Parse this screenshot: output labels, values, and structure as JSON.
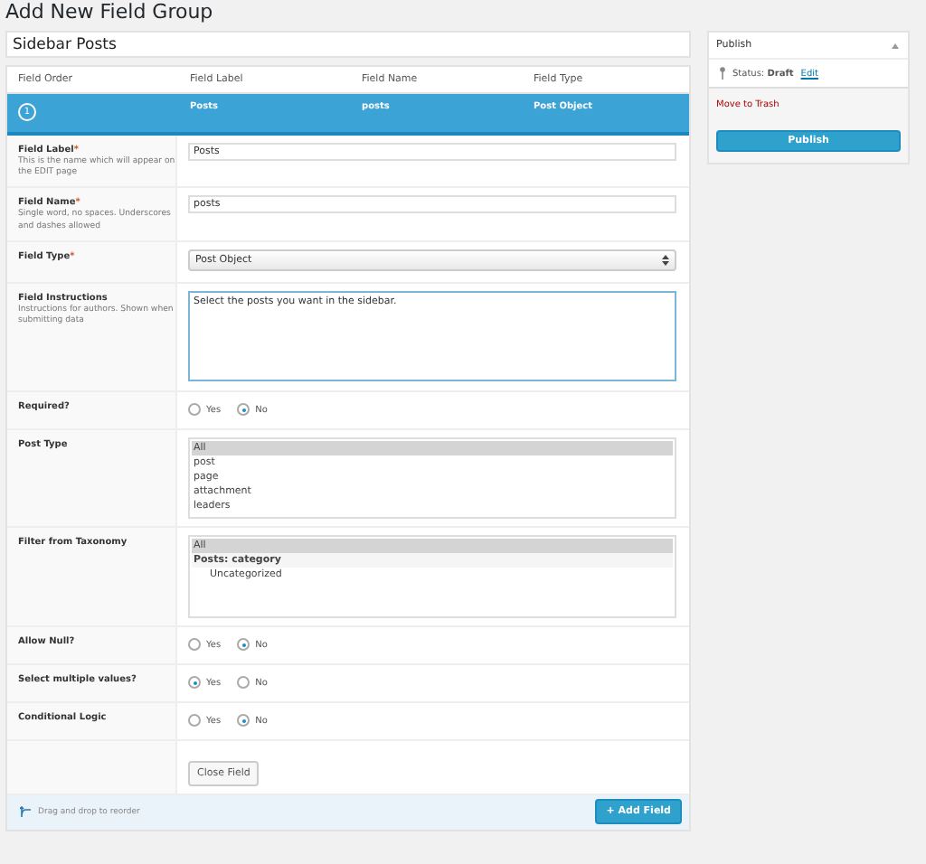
{
  "page_title": "Add New Field Group",
  "group_title": "Sidebar Posts",
  "table": {
    "columns": [
      "Field Order",
      "Field Label",
      "Field Name",
      "Field Type"
    ],
    "field": {
      "order": "1",
      "label": "Posts",
      "name": "posts",
      "type": "Post Object",
      "selected": true
    }
  },
  "rows": [
    {
      "kind": "text",
      "label": "Field Label",
      "required_mark": "*",
      "hint": "This is the name which will appear on the EDIT page",
      "value": "Posts"
    },
    {
      "kind": "text",
      "label": "Field Name",
      "required_mark": "*",
      "hint": "Single word, no spaces. Underscores and dashes allowed",
      "value": "posts"
    },
    {
      "kind": "select",
      "label": "Field Type",
      "required_mark": "*",
      "value": "Post Object"
    },
    {
      "kind": "textarea",
      "label": "Field Instructions",
      "hint": "Instructions for authors. Shown when submitting data",
      "value": "Select the posts you want in the sidebar."
    },
    {
      "kind": "radio",
      "label": "Required?",
      "options": [
        {
          "label": "Yes",
          "selected": false
        },
        {
          "label": "No",
          "selected": true
        }
      ]
    },
    {
      "kind": "listbox",
      "label": "Post Type",
      "options": [
        {
          "label": "All",
          "selected": true
        },
        {
          "label": "post",
          "selected": false
        },
        {
          "label": "page",
          "selected": false
        },
        {
          "label": "attachment",
          "selected": false
        },
        {
          "label": "leaders",
          "selected": false
        }
      ]
    },
    {
      "kind": "listbox",
      "label": "Filter from Taxonomy",
      "options": [
        {
          "label": "All",
          "selected": true
        },
        {
          "label": "Posts: category",
          "kind": "group",
          "children": [
            {
              "label": "Uncategorized",
              "selected": false
            }
          ]
        }
      ]
    },
    {
      "kind": "radio",
      "label": "Allow Null?",
      "options": [
        {
          "label": "Yes",
          "selected": false
        },
        {
          "label": "No",
          "selected": true
        }
      ]
    },
    {
      "kind": "radio",
      "label": "Select multiple values?",
      "options": [
        {
          "label": "Yes",
          "selected": true
        },
        {
          "label": "No",
          "selected": false
        }
      ]
    },
    {
      "kind": "radio",
      "label": "Conditional Logic",
      "options": [
        {
          "label": "Yes",
          "selected": false
        },
        {
          "label": "No",
          "selected": true
        }
      ]
    },
    {
      "kind": "button",
      "label": "Close Field"
    }
  ],
  "footer": {
    "hint": "Drag and drop to reorder",
    "button": "+ Add Field"
  },
  "publish": {
    "title": "Publish",
    "status_label": "Status:",
    "status": "Draft",
    "edit": "Edit",
    "trash": "Move to Trash",
    "button": "Publish"
  }
}
